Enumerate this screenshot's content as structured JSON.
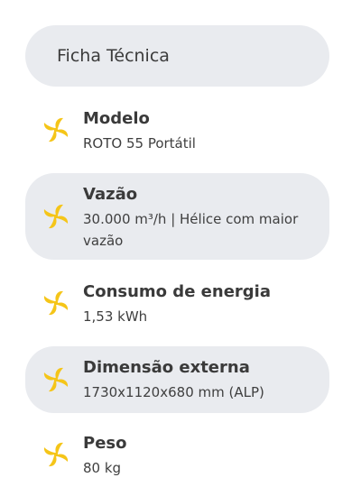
{
  "header": {
    "title": "Ficha Técnica"
  },
  "colors": {
    "accent": "#f5c518",
    "pill_bg": "#e9ebef",
    "text": "#3a3a3a"
  },
  "specs": [
    {
      "title": "Modelo",
      "value": "ROTO 55 Portátil",
      "icon": "fan-icon"
    },
    {
      "title": "Vazão",
      "value": "30.000 m³/h | Hélice com maior vazão",
      "icon": "fan-icon"
    },
    {
      "title": "Consumo de energia",
      "value": "1,53 kWh",
      "icon": "fan-icon"
    },
    {
      "title": "Dimensão externa",
      "value": "1730x1120x680 mm (ALP)",
      "icon": "fan-icon"
    },
    {
      "title": "Peso",
      "value": "80 kg",
      "icon": "fan-icon"
    }
  ]
}
